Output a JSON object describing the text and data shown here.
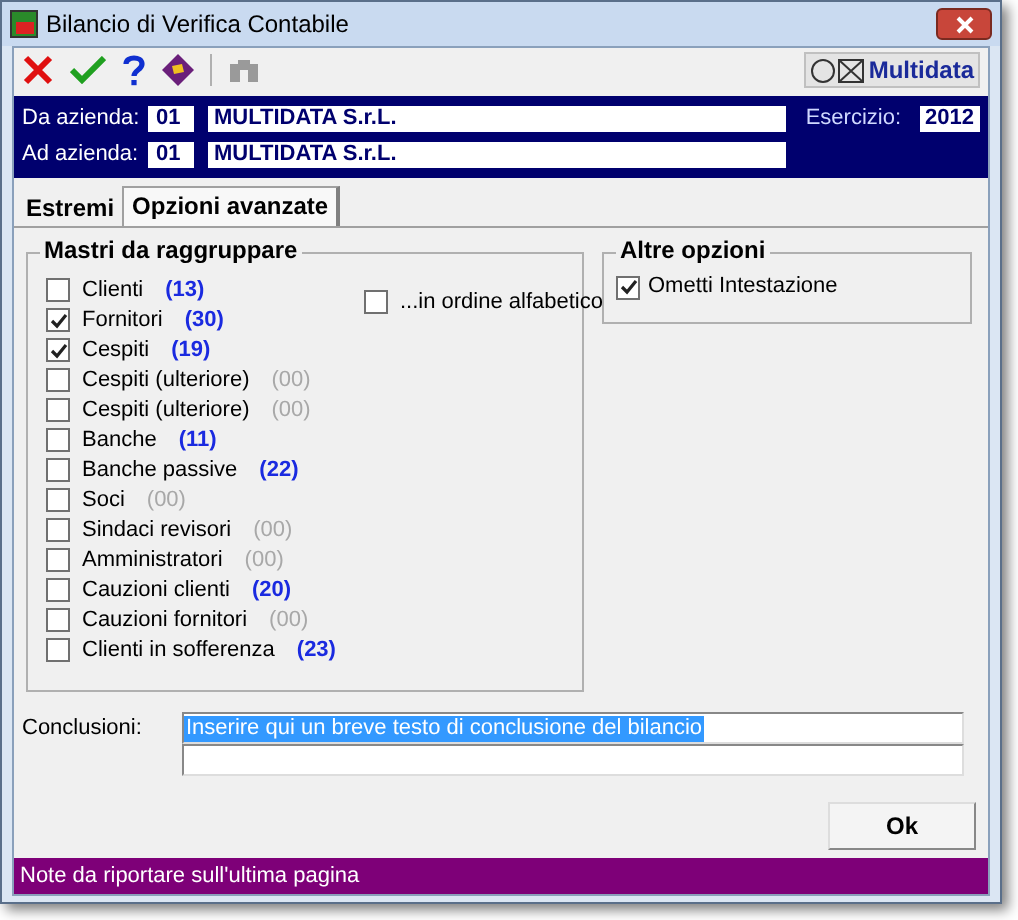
{
  "window": {
    "title": "Bilancio di Verifica Contabile"
  },
  "toolbar": {
    "brand": "Multidata"
  },
  "header": {
    "from_label": "Da azienda:",
    "from_code": "01",
    "from_name": "MULTIDATA S.r.L.",
    "to_label": "Ad azienda:",
    "to_code": "01",
    "to_name": "MULTIDATA S.r.L.",
    "year_label": "Esercizio:",
    "year": "2012"
  },
  "tabs": [
    {
      "label": "Estremi",
      "selected": false
    },
    {
      "label": "Opzioni avanzate",
      "selected": true
    }
  ],
  "mastri": {
    "title": "Mastri da raggruppare",
    "items": [
      {
        "label": "Clienti",
        "count": "(13)",
        "checked": false,
        "muted": false
      },
      {
        "label": "Fornitori",
        "count": "(30)",
        "checked": true,
        "muted": false
      },
      {
        "label": "Cespiti",
        "count": "(19)",
        "checked": true,
        "muted": false
      },
      {
        "label": "Cespiti (ulteriore)",
        "count": "(00)",
        "checked": false,
        "muted": true
      },
      {
        "label": "Cespiti (ulteriore)",
        "count": "(00)",
        "checked": false,
        "muted": true
      },
      {
        "label": "Banche",
        "count": "(11)",
        "checked": false,
        "muted": false
      },
      {
        "label": "Banche passive",
        "count": "(22)",
        "checked": false,
        "muted": false
      },
      {
        "label": "Soci",
        "count": "(00)",
        "checked": false,
        "muted": true
      },
      {
        "label": "Sindaci revisori",
        "count": "(00)",
        "checked": false,
        "muted": true
      },
      {
        "label": "Amministratori",
        "count": "(00)",
        "checked": false,
        "muted": true
      },
      {
        "label": "Cauzioni clienti",
        "count": "(20)",
        "checked": false,
        "muted": false
      },
      {
        "label": "Cauzioni fornitori",
        "count": "(00)",
        "checked": false,
        "muted": true
      },
      {
        "label": "Clienti in sofferenza",
        "count": "(23)",
        "checked": false,
        "muted": false
      }
    ],
    "alphabetic": {
      "label": "...in ordine alfabetico",
      "checked": false
    }
  },
  "altre": {
    "title": "Altre opzioni",
    "items": [
      {
        "label": "Ometti Intestazione",
        "checked": true
      }
    ]
  },
  "conclusioni": {
    "label": "Conclusioni:",
    "line1": "Inserire qui un breve testo di conclusione del bilancio"
  },
  "ok_button": "Ok",
  "status_bar": "Note da riportare sull'ultima pagina"
}
